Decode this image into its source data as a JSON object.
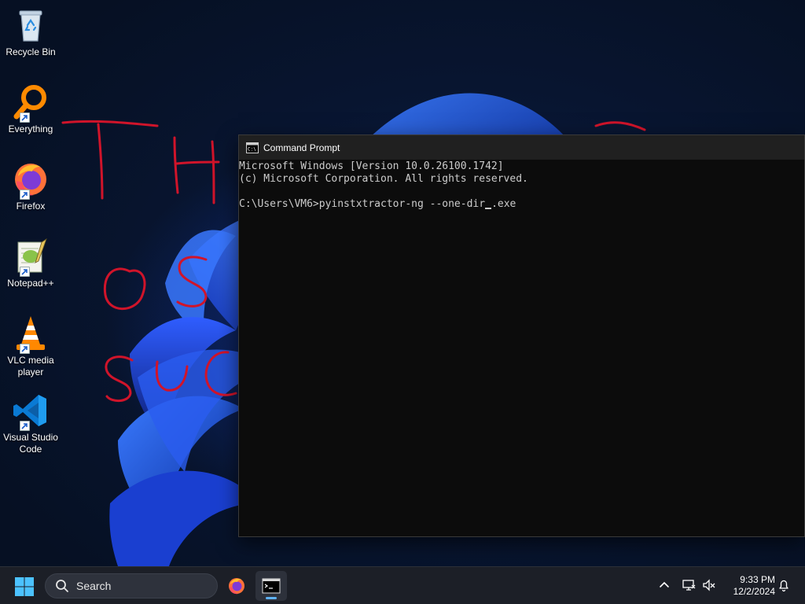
{
  "desktop": {
    "icons": [
      {
        "label": "Recycle Bin",
        "icon": "recycle-bin-icon",
        "shortcut": false
      },
      {
        "label": "Everything",
        "icon": "everything-search-icon",
        "shortcut": true
      },
      {
        "label": "Firefox",
        "icon": "firefox-icon",
        "shortcut": true
      },
      {
        "label": "Notepad++",
        "icon": "notepad-plus-plus-icon",
        "shortcut": true
      },
      {
        "label": "VLC media player",
        "icon": "vlc-icon",
        "shortcut": true
      },
      {
        "label": "Visual Studio Code",
        "icon": "vscode-icon",
        "shortcut": true
      }
    ]
  },
  "cmd_window": {
    "title": "Command Prompt",
    "lines": [
      "Microsoft Windows [Version 10.0.26100.1742]",
      "(c) Microsoft Corporation. All rights reserved.",
      "",
      "C:\\Users\\VM6>pyinstxtractor-ng --one-dir"
    ],
    "cursor_after": ".exe"
  },
  "taskbar": {
    "search_placeholder": "Search",
    "apps": [
      "firefox-icon",
      "command-prompt-icon"
    ],
    "active_app": "command-prompt-icon"
  },
  "clock": {
    "time": "9:33 PM",
    "date": "12/2/2024"
  },
  "colors": {
    "terminal_bg": "#0c0c0c",
    "terminal_text": "#cccccc",
    "taskbar_bg": "#1c1f27",
    "accent": "#5fb2f2"
  }
}
